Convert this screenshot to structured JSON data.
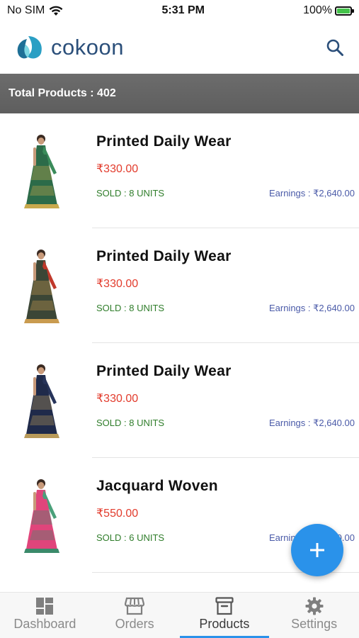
{
  "status_bar": {
    "carrier": "No SIM",
    "time": "5:31 PM",
    "battery": "100%",
    "battery_level": 1.0
  },
  "header": {
    "brand": "cokoon",
    "brand_color": "#2b4f7a",
    "search_icon": "search-icon"
  },
  "summary": {
    "total_products_text": "Total Products : 402"
  },
  "products": [
    {
      "title": "Printed Daily Wear",
      "price": "₹330.00",
      "sold": "SOLD : 8 UNITS",
      "earnings": "Earnings : ₹2,640.00",
      "colors": {
        "main": "#2c6b49",
        "accent": "#c8a94d",
        "pallu": "#3a8b5a"
      }
    },
    {
      "title": "Printed Daily Wear",
      "price": "₹330.00",
      "sold": "SOLD : 8 UNITS",
      "earnings": "Earnings : ₹2,640.00",
      "colors": {
        "main": "#3b4636",
        "accent": "#c99b4f",
        "pallu": "#c0392b"
      }
    },
    {
      "title": "Printed Daily Wear",
      "price": "₹330.00",
      "sold": "SOLD : 8 UNITS",
      "earnings": "Earnings : ₹2,640.00",
      "colors": {
        "main": "#1f2a4a",
        "accent": "#b89a5a",
        "pallu": "#27345a"
      }
    },
    {
      "title": "Jacquard Woven",
      "price": "₹550.00",
      "sold": "SOLD : 6 UNITS",
      "earnings": "Earnings : ₹3,300.00",
      "colors": {
        "main": "#e0457b",
        "accent": "#3a8a6a",
        "pallu": "#4aa07a"
      }
    }
  ],
  "fab": {
    "icon": "plus-icon",
    "color": "#2a92ea"
  },
  "nav": {
    "items": [
      {
        "label": "Dashboard",
        "icon": "dashboard-icon"
      },
      {
        "label": "Orders",
        "icon": "store-icon"
      },
      {
        "label": "Products",
        "icon": "archive-box-icon"
      },
      {
        "label": "Settings",
        "icon": "gear-icon"
      }
    ],
    "active": "Products"
  },
  "colors": {
    "price": "#e23b2c",
    "sold": "#2f7d2a",
    "earnings": "#4a5aa8",
    "accent": "#2a92ea"
  }
}
